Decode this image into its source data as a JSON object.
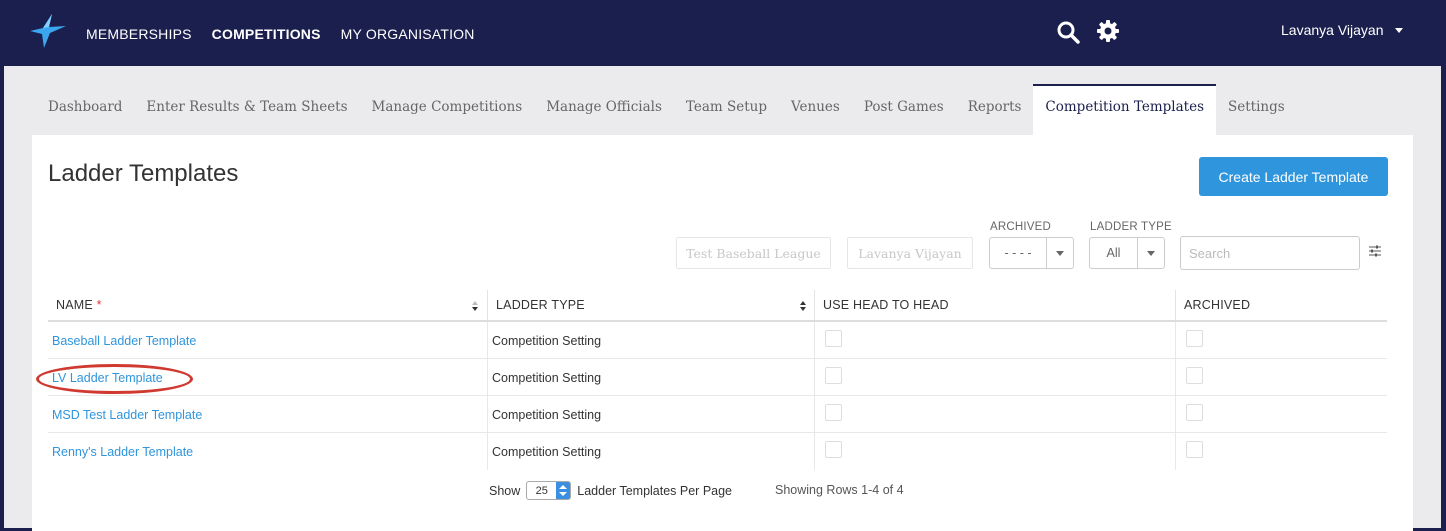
{
  "topnav": {
    "items": [
      {
        "label": "MEMBERSHIPS",
        "active": false
      },
      {
        "label": "COMPETITIONS",
        "active": true
      },
      {
        "label": "MY ORGANISATION",
        "active": false
      }
    ],
    "user_name": "Lavanya Vijayan"
  },
  "tabs": [
    {
      "label": "Dashboard",
      "active": false
    },
    {
      "label": "Enter Results & Team Sheets",
      "active": false
    },
    {
      "label": "Manage Competitions",
      "active": false
    },
    {
      "label": "Manage Officials",
      "active": false
    },
    {
      "label": "Team Setup",
      "active": false
    },
    {
      "label": "Venues",
      "active": false
    },
    {
      "label": "Post Games",
      "active": false
    },
    {
      "label": "Reports",
      "active": false
    },
    {
      "label": "Competition Templates",
      "active": true
    },
    {
      "label": "Settings",
      "active": false
    }
  ],
  "page": {
    "title": "Ladder Templates",
    "create_button": "Create Ladder Template"
  },
  "filters": {
    "league_button": "Test Baseball League",
    "user_button": "Lavanya Vijayan",
    "archived_label": "ARCHIVED",
    "archived_value": "- - - -",
    "ladder_type_label": "LADDER TYPE",
    "ladder_type_value": "All",
    "search_placeholder": "Search"
  },
  "table": {
    "columns": {
      "name": "NAME",
      "name_required": "*",
      "ladder_type": "LADDER TYPE",
      "use_head_to_head": "USE HEAD TO HEAD",
      "archived": "ARCHIVED"
    },
    "rows": [
      {
        "name": "Baseball Ladder Template",
        "ladder_type": "Competition Setting",
        "use_head_to_head": false,
        "archived": false
      },
      {
        "name": "LV Ladder Template",
        "ladder_type": "Competition Setting",
        "use_head_to_head": false,
        "archived": false,
        "highlighted": true
      },
      {
        "name": "MSD Test Ladder Template",
        "ladder_type": "Competition Setting",
        "use_head_to_head": false,
        "archived": false
      },
      {
        "name": "Renny's Ladder Template",
        "ladder_type": "Competition Setting",
        "use_head_to_head": false,
        "archived": false
      }
    ]
  },
  "footer": {
    "show_label": "Show",
    "per_page_value": "25",
    "per_page_label": "Ladder Templates Per Page",
    "showing_text": "Showing Rows 1-4 of 4"
  },
  "colors": {
    "nav_bg": "#1b1f4e",
    "accent": "#2f95dc",
    "highlight_circle": "#d0392f"
  }
}
